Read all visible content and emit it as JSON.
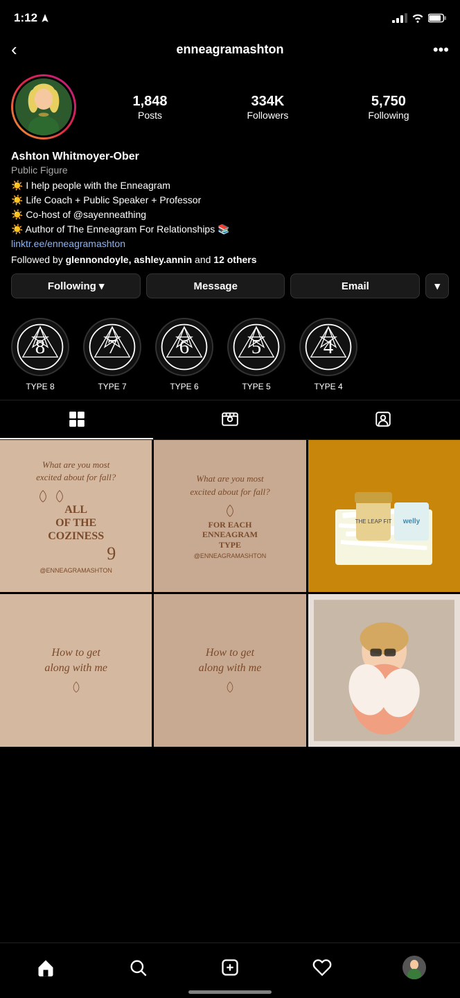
{
  "statusBar": {
    "time": "1:12",
    "timeIcon": "location-arrow-icon"
  },
  "header": {
    "backLabel": "‹",
    "username": "enneagramashton",
    "moreLabel": "•••"
  },
  "profile": {
    "stats": [
      {
        "number": "1,848",
        "label": "Posts"
      },
      {
        "number": "334K",
        "label": "Followers"
      },
      {
        "number": "5,750",
        "label": "Following"
      }
    ],
    "name": "Ashton Whitmoyer-Ober",
    "category": "Public Figure",
    "bioLines": [
      "🌟 I help people with the Enneagram",
      "🌟 Life Coach + Public Speaker + Professor",
      "🌟 Co-host of @sayenneathing",
      "🌟 Author of The Enneagram For Relationships 📚",
      "linktr.ee/enneagramashton"
    ],
    "followedBy": "Followed by ",
    "followedNames": "glennondoyle, ashley.annin",
    "followedSuffix": " and 12 others"
  },
  "buttons": {
    "following": "Following",
    "message": "Message",
    "email": "Email",
    "dropdownArrow": "▾"
  },
  "highlights": [
    {
      "number": "8",
      "label": "TYPE 8"
    },
    {
      "number": "7",
      "label": "TYPE 7"
    },
    {
      "number": "6",
      "label": "TYPE 6"
    },
    {
      "number": "5",
      "label": "TYPE 5"
    },
    {
      "number": "4",
      "label": "TYPE 4"
    }
  ],
  "tabs": [
    {
      "id": "grid",
      "label": "grid",
      "active": true
    },
    {
      "id": "reels",
      "label": "reels",
      "active": false
    },
    {
      "id": "tagged",
      "label": "tagged",
      "active": false
    }
  ],
  "gridItems": [
    {
      "id": 1,
      "style": "thumb-1",
      "type": "text",
      "line1": "What are you most",
      "line2": "excited about for fall?",
      "line3": "ALL OF THE COZINESS",
      "tag": "@ENNEAGRAMASHTON",
      "num": "9"
    },
    {
      "id": 2,
      "style": "thumb-2",
      "type": "text",
      "line1": "What are you most",
      "line2": "excited about for fall?",
      "line3": "FOR EACH ENNEAGRAM TYPE",
      "tag": "@ENNEAGRAMASHTON",
      "num": ""
    },
    {
      "id": 3,
      "style": "thumb-3",
      "type": "product"
    },
    {
      "id": 4,
      "style": "thumb-4",
      "type": "text2",
      "line1": "How to get",
      "line2": "along with me"
    },
    {
      "id": 5,
      "style": "thumb-5",
      "type": "text2",
      "line1": "How to get",
      "line2": "along with me"
    },
    {
      "id": 6,
      "style": "thumb-6",
      "type": "photo"
    }
  ],
  "bottomNav": {
    "home": "home",
    "search": "search",
    "create": "create",
    "activity": "activity",
    "profile": "profile"
  },
  "colors": {
    "accent": "#fff",
    "background": "#000",
    "border": "#333",
    "bioLink": "#8ab4f8"
  }
}
